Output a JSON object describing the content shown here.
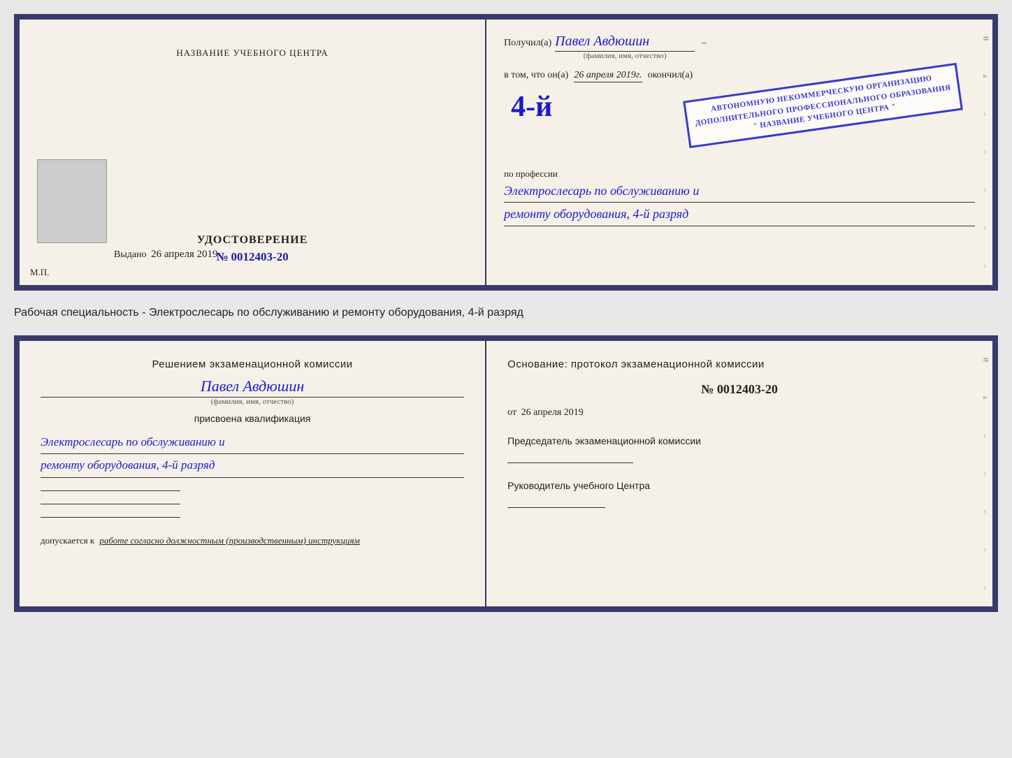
{
  "top_doc": {
    "left": {
      "center_title": "НАЗВАНИЕ УЧЕБНОГО ЦЕНТРА",
      "cert_title": "УДОСТОВЕРЕНИЕ",
      "cert_number_prefix": "№",
      "cert_number": "0012403-20",
      "issued_prefix": "Выдано",
      "issued_date": "26 апреля 2019",
      "mp_label": "М.П."
    },
    "right": {
      "recipient_prefix": "Получил(а)",
      "recipient_name": "Павел Авдюшин",
      "fio_label": "(фамилия, имя, отчество)",
      "in_that": "в том, что он(а)",
      "date_italic": "26 апреля 2019г.",
      "finished": "окончил(а)",
      "rank_number": "4-й",
      "org_line1": "АВТОНОМНУЮ НЕКОММЕРЧЕСКУЮ ОРГАНИЗАЦИЮ",
      "org_line2": "ДОПОЛНИТЕЛЬНОГО ПРОФЕССИОНАЛЬНОГО ОБРАЗОВАНИЯ",
      "org_line3": "\" НАЗВАНИЕ УЧЕБНОГО ЦЕНТРА \"",
      "profession_label": "по профессии",
      "profession_line1": "Электрослесарь по обслуживанию и",
      "profession_line2": "ремонту оборудования, 4-й разряд"
    }
  },
  "divider": {
    "text": "Рабочая специальность - Электрослесарь по обслуживанию и ремонту оборудования, 4-й разряд"
  },
  "bottom_doc": {
    "left": {
      "decision_title": "Решением экзаменационной комиссии",
      "person_name": "Павел Авдюшин",
      "fio_label": "(фамилия, имя, отчество)",
      "assigned_label": "присвоена квалификация",
      "qualification_line1": "Электрослесарь по обслуживанию и",
      "qualification_line2": "ремонту оборудования, 4-й разряд",
      "allowed_prefix": "допускается к",
      "allowed_text": "работе согласно должностным (производственным) инструкциям"
    },
    "right": {
      "basis_title": "Основание: протокол экзаменационной комиссии",
      "protocol_number": "№ 0012403-20",
      "date_prefix": "от",
      "date": "26 апреля 2019",
      "chairman_title": "Председатель экзаменационной комиссии",
      "director_title": "Руководитель учебного Центра"
    }
  },
  "edge_marks": [
    "И",
    "а",
    "←",
    "–",
    "–",
    "–",
    "–"
  ],
  "edge_marks2": [
    "И",
    "а",
    "←",
    "–",
    "–",
    "–",
    "–"
  ]
}
